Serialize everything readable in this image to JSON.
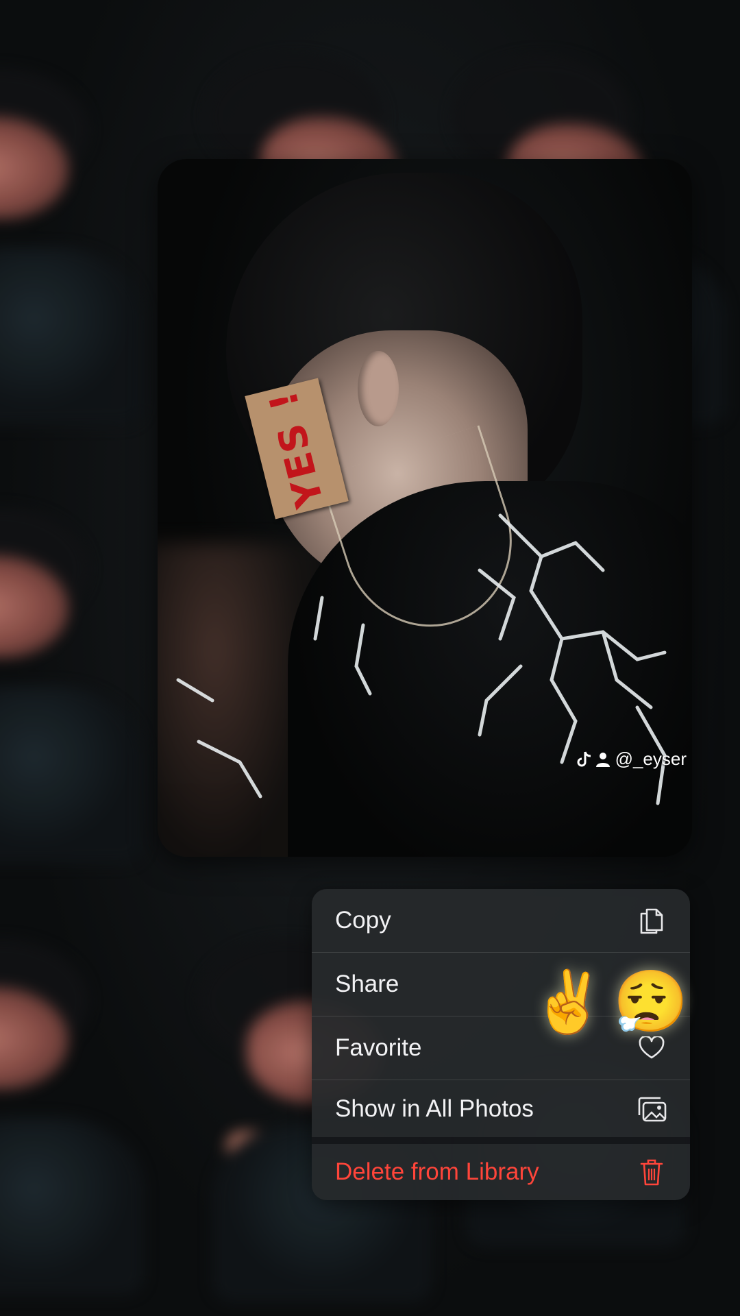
{
  "watermark": {
    "handle": "@_eyser",
    "icons": [
      "tiktok-icon",
      "person-icon"
    ]
  },
  "sticker": {
    "text": "YES !"
  },
  "context_menu": {
    "items": [
      {
        "label": "Copy",
        "icon": "copy-icon",
        "destructive": false
      },
      {
        "label": "Share",
        "icon": "share-icon",
        "destructive": false
      },
      {
        "label": "Favorite",
        "icon": "heart-icon",
        "destructive": false
      },
      {
        "label": "Show in All Photos",
        "icon": "photos-icon",
        "destructive": false
      },
      {
        "label": "Delete from Library",
        "icon": "trash-icon",
        "destructive": true
      }
    ]
  },
  "overlay_emojis": [
    "✌️",
    "😮‍💨"
  ],
  "colors": {
    "destructive": "#ff453a",
    "menu_background": "#26292c",
    "menu_text": "#f2f2f4"
  }
}
